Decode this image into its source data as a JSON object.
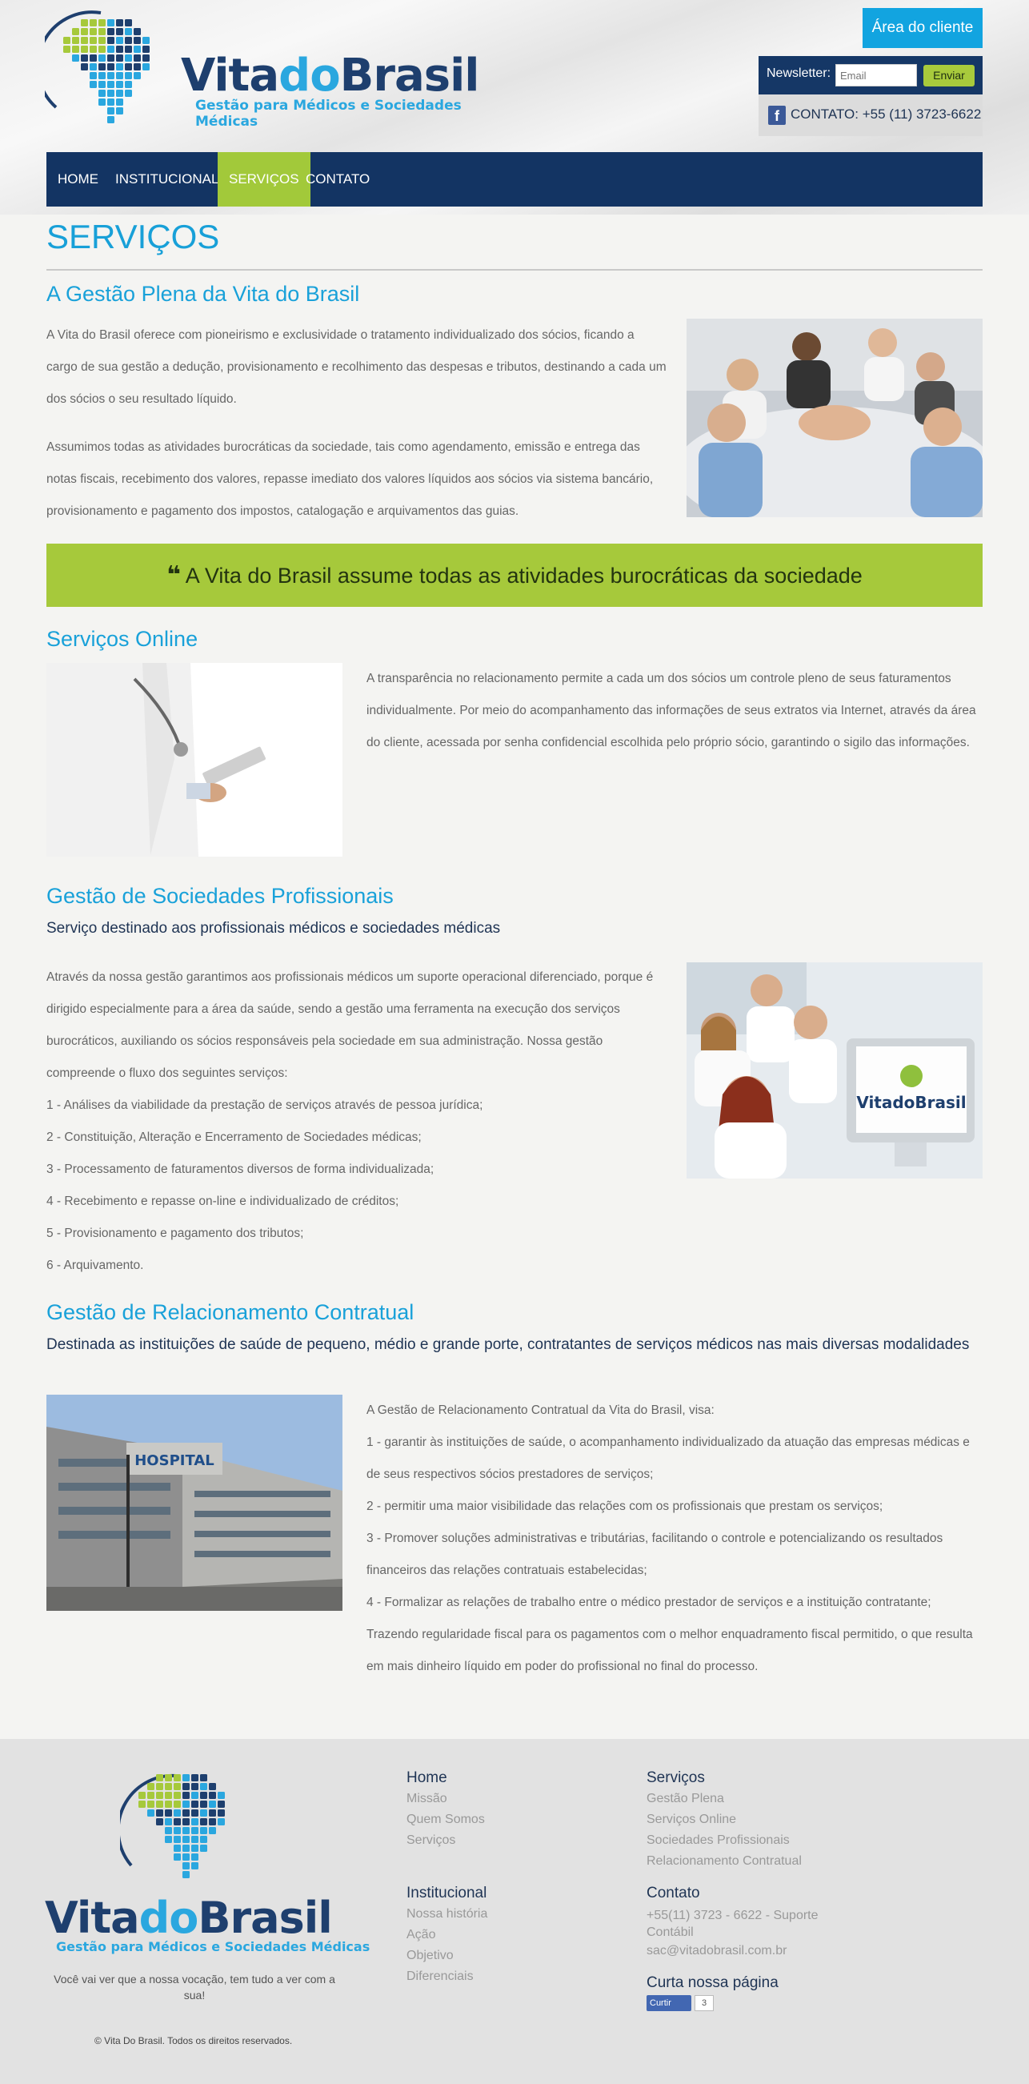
{
  "header": {
    "logo": {
      "word_part1": "Vita",
      "word_part2": "do",
      "word_part3": "Brasil",
      "tagline": "Gestão para Médicos e Sociedades Médicas"
    },
    "area_cliente_label": "Área do cliente",
    "newsletter": {
      "label": "Newsletter:",
      "placeholder": "Email",
      "button": "Enviar"
    },
    "contact": {
      "icon": "facebook-icon",
      "text": "CONTATO: +55 (11) 3723-6622"
    }
  },
  "nav": {
    "items": [
      {
        "label": "HOME",
        "active": false
      },
      {
        "label": "INSTITUCIONAL",
        "active": false
      },
      {
        "label": "SERVIÇOS",
        "active": true
      },
      {
        "label": "CONTATO",
        "active": false
      }
    ]
  },
  "main": {
    "page_title": "SERVIÇOS",
    "gestao_plena": {
      "title": "A Gestão Plena da Vita do Brasil",
      "paragraphs": [
        "A Vita do Brasil oferece com pioneirismo e exclusividade o tratamento individualizado dos sócios, ficando a cargo de sua gestão a dedução, provisionamento e recolhimento das despesas e tributos, destinando a cada um dos sócios o seu resultado líquido.",
        "Assumimos todas as atividades burocráticas da sociedade, tais como agendamento, emissão e entrega das notas fiscais, recebimento dos valores, repasse imediato dos valores líquidos aos sócios via sistema bancário, provisionamento e pagamento dos impostos, catalogação e arquivamentos das guias."
      ]
    },
    "banner": {
      "icon": "quote-icon",
      "text": "A Vita do Brasil assume todas as atividades burocráticas da sociedade"
    },
    "servicos_online": {
      "title": "Serviços Online",
      "paragraph": "A transparência no relacionamento permite a cada um dos sócios um controle pleno de seus faturamentos individualmente. Por meio do acompanhamento das informações de seus extratos via Internet, através da área do cliente, acessada por senha confidencial escolhida pelo próprio sócio, garantindo o sigilo das informações."
    },
    "sociedades": {
      "title": "Gestão de Sociedades Profissionais",
      "subtitle": "Serviço destinado aos profissionais médicos e sociedades médicas",
      "intro": "Através da nossa gestão garantimos aos profissionais médicos um suporte operacional diferenciado, porque é dirigido especialmente para a área da saúde, sendo a gestão uma ferramenta na execução dos serviços burocráticos, auxiliando os sócios responsáveis pela sociedade em sua administração. Nossa gestão compreende o fluxo dos seguintes serviços:",
      "items": [
        "1 - Análises da viabilidade da prestação de serviços através de pessoa jurídica;",
        "2 - Constituição, Alteração e Encerramento de Sociedades médicas;",
        "3 - Processamento de faturamentos diversos de forma individualizada;",
        "4 - Recebimento e repasse on-line e individualizado de créditos;",
        "5 - Provisionamento e pagamento dos tributos;",
        "6 - Arquivamento."
      ],
      "screen_logo": "VitadoBrasil"
    },
    "contratual": {
      "title": "Gestão de Relacionamento Contratual",
      "subtitle": "Destinada as instituições de saúde de pequeno, médio e grande porte, contratantes de serviços médicos nas mais diversas modalidades",
      "lines": [
        "A Gestão de Relacionamento Contratual da Vita do Brasil, visa:",
        "1 - garantir às instituições de saúde, o acompanhamento individualizado da atuação das empresas médicas e de seus respectivos sócios prestadores de serviços;",
        "2 - permitir uma maior visibilidade das relações com os profissionais que prestam os serviços;",
        "3 - Promover soluções administrativas e tributárias, facilitando o controle e potencializando os resultados financeiros das relações contratuais estabelecidas;",
        "4 - Formalizar as relações de trabalho entre o médico prestador de serviços e a instituição contratante;",
        "Trazendo regularidade fiscal para os pagamentos com o melhor enquadramento fiscal permitido, o que resulta em mais dinheiro líquido em poder do profissional no final do processo."
      ],
      "building_sign": "HOSPITAL"
    }
  },
  "footer": {
    "logo": {
      "word_part1": "Vita",
      "word_part2": "do",
      "word_part3": "Brasil",
      "tagline": "Gestão para Médicos e Sociedades Médicas"
    },
    "slogan": "Você vai ver que a nossa vocação, tem tudo a ver com a sua!",
    "copyright": "© Vita Do Brasil. Todos os direitos reservados.",
    "home": {
      "title": "Home",
      "links": [
        "Missão",
        "Quem Somos",
        "Serviços"
      ]
    },
    "institucional": {
      "title": "Institucional",
      "links": [
        "Nossa história",
        "Ação",
        "Objetivo",
        "Diferenciais"
      ]
    },
    "servicos": {
      "title": "Serviços",
      "links": [
        "Gestão Plena",
        "Serviços Online",
        "Sociedades Profissionais",
        "Relacionamento Contratual"
      ]
    },
    "contato": {
      "title": "Contato",
      "phone": "+55(11) 3723 - 6622 - Suporte Contábil",
      "email": "sac@vitadobrasil.com.br"
    },
    "curta": {
      "title": "Curta nossa página",
      "like_label": "Curtir",
      "like_count": "3"
    }
  },
  "colors": {
    "navy": "#133463",
    "blue": "#19a1d9",
    "green": "#a6c93b"
  }
}
